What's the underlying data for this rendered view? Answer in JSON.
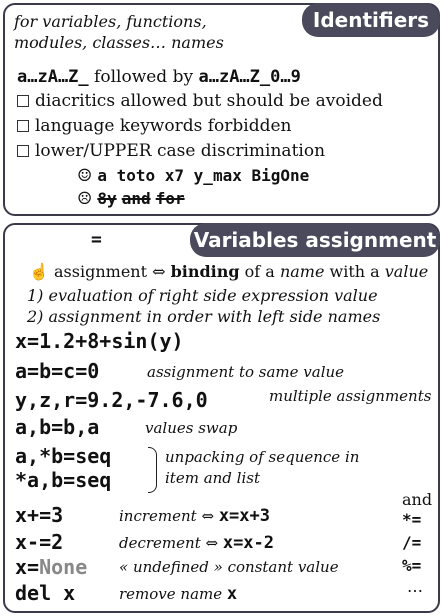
{
  "identifiers": {
    "title": "Identifiers",
    "desc_line1": "for variables, functions,",
    "desc_line2": "modules, classes… names",
    "rule_a": "a…zA…Z_",
    "rule_b": " followed by ",
    "rule_c": "a…zA…Z_0…9",
    "bullets": [
      "diacritics allowed but should be avoided",
      "language keywords forbidden",
      "lower/UPPER case discrimination"
    ],
    "good_icon": "☺",
    "good_examples": "a toto x7 y_max BigOne",
    "bad_icon": "☹",
    "bad_examples": [
      "8y",
      "and",
      "for"
    ]
  },
  "assignment": {
    "title": "Variables assignment",
    "symbol": "=",
    "hand_icon": "☝",
    "def_a": "assignment ⇔ ",
    "def_b": "binding",
    "def_c": " of a ",
    "def_d": "name",
    "def_e": " with a ",
    "def_f": "value",
    "step1": "1) evaluation of right side expression value",
    "step2": "2) assignment in order with left side names",
    "rows": {
      "r1_code": "x=1.2+8+sin(y)",
      "r2_code": "a=b=c=0",
      "r2_note": "assignment to same value",
      "r3_code": "y,z,r=9.2,-7.6,0",
      "r3_note": "multiple assignments",
      "r4_code": "a,b=b,a",
      "r4_note": "values swap",
      "r5_code": "a,*b=seq",
      "r6_code": "*a,b=seq",
      "unpack_line1": "unpacking of sequence in",
      "unpack_line2": "item and list",
      "r7_code": "x+=3",
      "r7_note": "increment ⇔ ",
      "r7_eq": "x=x+3",
      "r8_code": "x-=2",
      "r8_note": "decrement ⇔ ",
      "r8_eq": "x=x-2",
      "r9_code_a": "x=",
      "r9_code_b": "None",
      "r9_note": "« undefined » constant value",
      "r10_code": "del x",
      "r10_note": "remove name ",
      "r10_x": "x"
    },
    "and_label": "and",
    "ops": [
      "*=",
      "/=",
      "%=",
      "…"
    ]
  }
}
